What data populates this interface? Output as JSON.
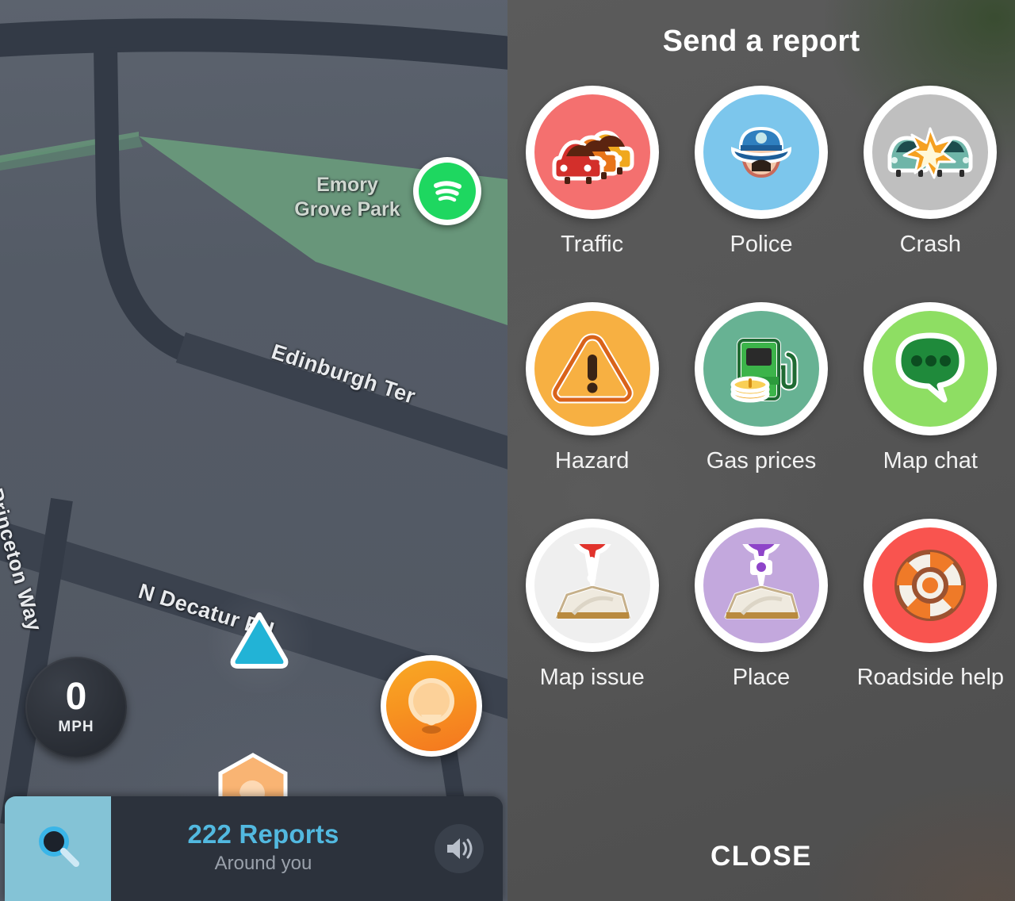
{
  "map": {
    "background_color": "#545b66",
    "park_label": "Emory\nGrove Park",
    "park_label_line1": "Emory",
    "park_label_line2": "Grove Park",
    "streets": [
      {
        "name": "Edinburgh Ter"
      },
      {
        "name": "N Decatur Rd"
      },
      {
        "name": "Princeton Way"
      }
    ],
    "speedometer": {
      "value": "0",
      "unit": "MPH"
    },
    "spotify_button": {
      "icon": "spotify-icon",
      "color": "#1ed760"
    },
    "report_fab": {
      "icon": "report-pin-icon",
      "color": "#f4761f"
    },
    "cluster_marker": {
      "icon": "chat-hexagon-icon",
      "color": "#f9b473"
    },
    "bottom_bar": {
      "search_icon": "search-icon",
      "search_bg": "#84c3d6",
      "reports_count": "222 Reports",
      "reports_sub": "Around you",
      "reports_color": "#52b9e0",
      "sound_icon": "speaker-icon"
    }
  },
  "panel": {
    "title": "Send a report",
    "background_color": "#575757",
    "close_label": "CLOSE",
    "items": [
      {
        "label": "Traffic",
        "icon": "traffic-cars-icon",
        "disc_color": "#f4706f"
      },
      {
        "label": "Police",
        "icon": "police-cap-icon",
        "disc_color": "#7cc6ec"
      },
      {
        "label": "Crash",
        "icon": "car-crash-icon",
        "disc_color": "#bfbfbf"
      },
      {
        "label": "Hazard",
        "icon": "warning-triangle-icon",
        "disc_color": "#f7b042"
      },
      {
        "label": "Gas prices",
        "icon": "gas-pump-icon",
        "disc_color": "#67b293"
      },
      {
        "label": "Map chat",
        "icon": "chat-bubble-icon",
        "disc_color": "#8ede63"
      },
      {
        "label": "Map issue",
        "icon": "map-alert-pin-icon",
        "disc_color": "#efefef"
      },
      {
        "label": "Place",
        "icon": "map-camera-pin-icon",
        "disc_color": "#c3a8dd"
      },
      {
        "label": "Roadside help",
        "icon": "lifebuoy-icon",
        "disc_color": "#f9544f"
      }
    ]
  }
}
